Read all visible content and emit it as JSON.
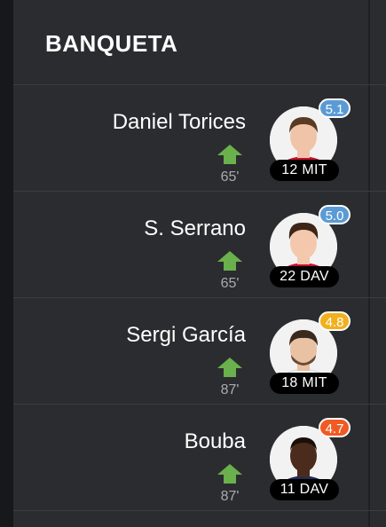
{
  "header": {
    "title": "BANQUETA"
  },
  "players": [
    {
      "name": "Daniel Torices",
      "minute": "65'",
      "rating": "5.1",
      "rating_color": "#5b9bd5",
      "number_position": "12 MIT",
      "kit_color": "#c8102e",
      "skin": "#f0c4a8",
      "hair": "#5a3a22"
    },
    {
      "name": "S. Serrano",
      "minute": "65'",
      "rating": "5.0",
      "rating_color": "#5b9bd5",
      "number_position": "22 DAV",
      "kit_color": "#c8102e",
      "skin": "#f3c8ad",
      "hair": "#3d2617"
    },
    {
      "name": "Sergi García",
      "minute": "87'",
      "rating": "4.8",
      "rating_color": "#f2b01e",
      "number_position": "18 MIT",
      "kit_color": "#f4f4f4",
      "skin": "#e9c1a3",
      "hair": "#3a2a1e"
    },
    {
      "name": "Bouba",
      "minute": "87'",
      "rating": "4.7",
      "rating_color": "#f05a23",
      "number_position": "11 DAV",
      "kit_color": "#1f2b5a",
      "skin": "#4a2b1c",
      "hair": "#1a100a"
    }
  ],
  "icons": {
    "substitution": "green-up-arrow-icon"
  }
}
